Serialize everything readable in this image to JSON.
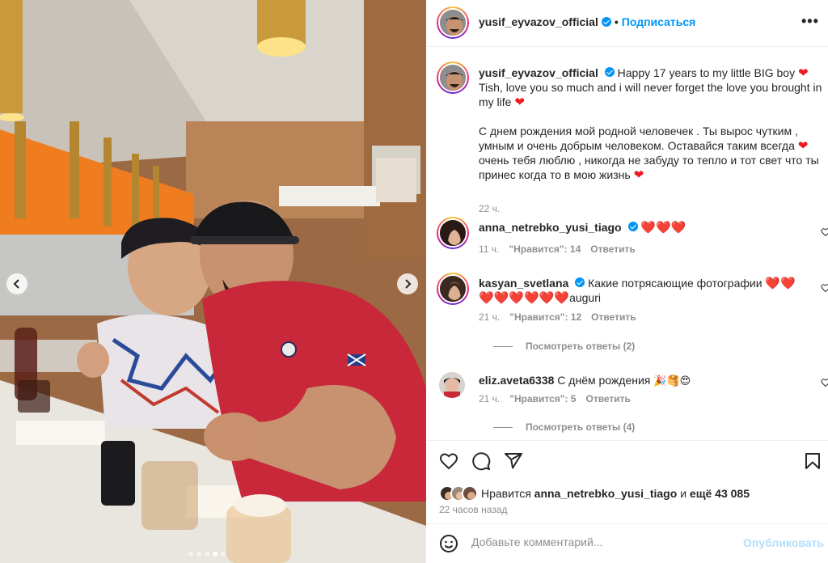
{
  "post": {
    "author": "yusif_eyvazov_official",
    "follow_label": "Подписаться",
    "separator": "•",
    "more_label": "•••",
    "carousel": {
      "slide_count": 5,
      "active_index": 3
    }
  },
  "caption": {
    "author": "yusif_eyvazov_official",
    "line1": "Happy 17 years to my little BIG boy",
    "line2": "Tish, love you so much and i will never forget the love you brought in my life",
    "para2": "С днем рождения мой родной человечек . Ты вырос чутким , умным и очень добрым человеком. Оставайся таким всегда",
    "para2b": "очень тебя люблю , никогда не забуду то тепло и тот свет что ты принес когда то в мою жизнь",
    "time": "22 ч."
  },
  "comments": [
    {
      "user": "anna_netrebko_yusi_tiago",
      "verified": true,
      "text": "",
      "hearts": "❤️❤️❤️",
      "time": "11 ч.",
      "likes": "\"Нравится\": 14",
      "reply": "Ответить"
    },
    {
      "user": "kasyan_svetlana",
      "verified": true,
      "text": "Какие потрясающие фотографии",
      "hearts": "❤️❤️",
      "line2_hearts": "❤️❤️❤️❤️❤️❤️",
      "line2_text": "auguri",
      "time": "21 ч.",
      "likes": "\"Нравится\": 12",
      "reply": "Ответить",
      "view_replies": "Посмотреть ответы (2)"
    },
    {
      "user": "eliz.aveta6338",
      "verified": false,
      "text": "С днём рождения",
      "emoji": "🎉🥞😍",
      "time": "21 ч.",
      "likes": "\"Нравится\": 5",
      "reply": "Ответить",
      "view_replies": "Посмотреть ответы (4)"
    }
  ],
  "actions": {
    "liked_by_prefix": "Нравится",
    "liked_by_user": "anna_netrebko_yusi_tiago",
    "liked_by_and": "и",
    "liked_by_rest": "ещё 43 085",
    "posted_ago": "22 часов назад",
    "comment_placeholder": "Добавьте комментарий...",
    "post_label": "Опубликовать"
  },
  "colors": {
    "accent": "#0095f6",
    "muted": "#8e8e8e",
    "post_disabled": "#b2dffc",
    "heart": "#ed1c24"
  },
  "icons": [
    "verified-badge-icon",
    "more-options-icon",
    "heart-icon",
    "comment-icon",
    "share-icon",
    "save-icon",
    "emoji-icon",
    "chevron-left-icon",
    "chevron-right-icon"
  ]
}
